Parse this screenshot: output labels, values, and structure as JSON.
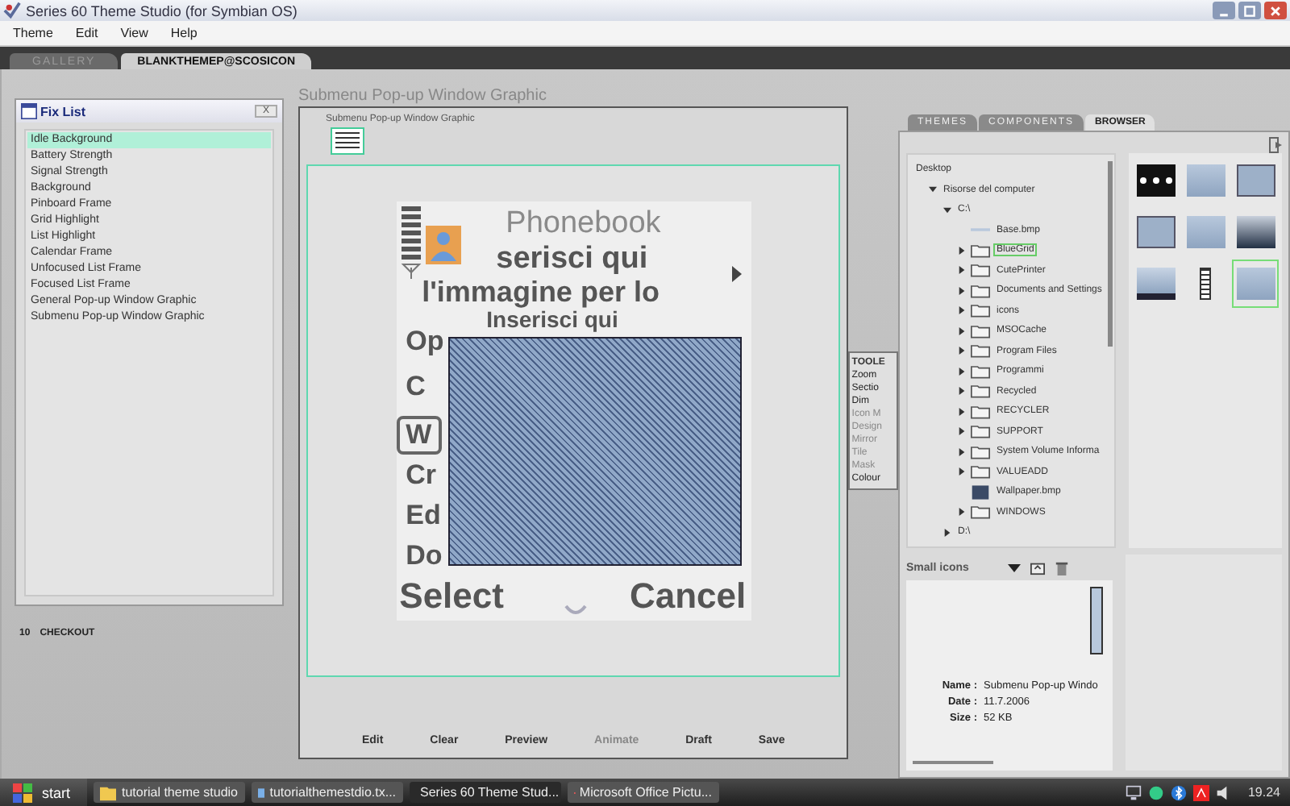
{
  "window": {
    "title": "Series 60 Theme Studio (for Symbian OS)"
  },
  "menu": [
    "Theme",
    "Edit",
    "View",
    "Help"
  ],
  "document_tabs": [
    {
      "label": "GALLERY",
      "selected": false
    },
    {
      "label": "BLANKTHEMEP@SCOSICON",
      "selected": true
    }
  ],
  "fix_list": {
    "title": "Fix List",
    "close_label": "X",
    "items": [
      {
        "label": "Idle Background",
        "selected": true
      },
      {
        "label": "Battery Strength",
        "selected": false
      },
      {
        "label": "Signal Strength",
        "selected": false
      },
      {
        "label": "Background",
        "selected": false
      },
      {
        "label": "Pinboard Frame",
        "selected": false
      },
      {
        "label": "Grid Highlight",
        "selected": false
      },
      {
        "label": "List Highlight",
        "selected": false
      },
      {
        "label": "Calendar Frame",
        "selected": false
      },
      {
        "label": "Unfocused List Frame",
        "selected": false
      },
      {
        "label": "Focused List Frame",
        "selected": false
      },
      {
        "label": "General Pop-up Window Graphic",
        "selected": false
      },
      {
        "label": "Submenu Pop-up Window Graphic",
        "selected": false
      }
    ]
  },
  "checkout": {
    "count": "10",
    "label": "CHECKOUT"
  },
  "editor": {
    "title": "Submenu Pop-up Window Graphic",
    "thumbnail_label": "Submenu Pop-up Window Graphic",
    "phone": {
      "title": "Phonebook",
      "overlay_lines": [
        "serisci qui",
        "l'immagine per lo",
        "Inserisci qui"
      ],
      "menu_letters": [
        {
          "label": "Op",
          "selected": false
        },
        {
          "label": "C",
          "selected": false
        },
        {
          "label": "W",
          "selected": true
        },
        {
          "label": "Cr",
          "selected": false
        },
        {
          "label": "Ed",
          "selected": false
        },
        {
          "label": "Do",
          "selected": false
        }
      ],
      "softkeys": [
        "Select",
        "Cancel"
      ]
    },
    "toolbar": [
      {
        "label": "Edit",
        "disabled": false
      },
      {
        "label": "Clear",
        "disabled": false
      },
      {
        "label": "Preview",
        "disabled": false
      },
      {
        "label": "Animate",
        "disabled": true
      },
      {
        "label": "Draft",
        "disabled": false
      },
      {
        "label": "Save",
        "disabled": false
      }
    ]
  },
  "tools_panel": {
    "title": "TOOLE",
    "items": [
      {
        "label": "Zoom",
        "disabled": false
      },
      {
        "label": "Sectio",
        "disabled": false
      },
      {
        "label": "Dim",
        "disabled": false
      },
      {
        "label": "Icon M",
        "disabled": true
      },
      {
        "label": "Design",
        "disabled": true
      },
      {
        "label": "Mirror",
        "disabled": true
      },
      {
        "label": "Tile",
        "disabled": true
      },
      {
        "label": "Mask",
        "disabled": true
      },
      {
        "label": "Colour",
        "disabled": false
      }
    ]
  },
  "browser": {
    "tabs": [
      {
        "label": "THEMES",
        "selected": false
      },
      {
        "label": "COMPONENTS",
        "selected": false
      },
      {
        "label": "BROWSER",
        "selected": true
      }
    ],
    "tree": [
      {
        "label": "Desktop",
        "selected": false,
        "children": [
          {
            "label": "Risorse del computer",
            "expanded": true,
            "selected": false,
            "children": [
              {
                "label": "C:\\",
                "expanded": true,
                "selected": false,
                "children": [
                  {
                    "label": "Base.bmp",
                    "kind": "file",
                    "selected": false
                  },
                  {
                    "label": "BlueGrid",
                    "kind": "folder",
                    "expanded": false,
                    "selected": true
                  },
                  {
                    "label": "CutePrinter",
                    "kind": "folder",
                    "expanded": false,
                    "selected": false
                  },
                  {
                    "label": "Documents and Settings",
                    "kind": "folder",
                    "expanded": false,
                    "selected": false
                  },
                  {
                    "label": "icons",
                    "kind": "folder",
                    "expanded": false,
                    "selected": false
                  },
                  {
                    "label": "MSOCache",
                    "kind": "folder",
                    "expanded": false,
                    "selected": false
                  },
                  {
                    "label": "Program Files",
                    "kind": "folder",
                    "expanded": false,
                    "selected": false
                  },
                  {
                    "label": "Programmi",
                    "kind": "folder",
                    "expanded": false,
                    "selected": false
                  },
                  {
                    "label": "Recycled",
                    "kind": "folder",
                    "expanded": false,
                    "selected": false
                  },
                  {
                    "label": "RECYCLER",
                    "kind": "folder",
                    "expanded": false,
                    "selected": false
                  },
                  {
                    "label": "SUPPORT",
                    "kind": "folder",
                    "expanded": false,
                    "selected": false
                  },
                  {
                    "label": "System Volume Informa",
                    "kind": "folder",
                    "expanded": false,
                    "selected": false
                  },
                  {
                    "label": "VALUEADD",
                    "kind": "folder",
                    "expanded": false,
                    "selected": false
                  },
                  {
                    "label": "Wallpaper.bmp",
                    "kind": "image",
                    "selected": false
                  },
                  {
                    "label": "WINDOWS",
                    "kind": "folder",
                    "expanded": false,
                    "selected": false
                  }
                ]
              },
              {
                "label": "D:\\",
                "expanded": false,
                "selected": false
              }
            ]
          }
        ]
      }
    ],
    "thumbnails": [
      {
        "kind": "dots",
        "selected": false
      },
      {
        "kind": "light",
        "selected": false
      },
      {
        "kind": "frame",
        "selected": false
      },
      {
        "kind": "frame",
        "selected": false
      },
      {
        "kind": "light",
        "selected": false
      },
      {
        "kind": "dark",
        "selected": false
      },
      {
        "kind": "gradient",
        "selected": false
      },
      {
        "kind": "ladder",
        "selected": false
      },
      {
        "kind": "light",
        "selected": true
      }
    ],
    "view_select": "Small icons",
    "info": [
      {
        "label": "Name :",
        "value": "Submenu Pop-up Windo"
      },
      {
        "label": "Date :",
        "value": "11.7.2006"
      },
      {
        "label": "Size :",
        "value": "52 KB"
      }
    ]
  },
  "taskbar": {
    "start": "start",
    "tasks": [
      {
        "label": "tutorial theme studio",
        "kind": "folder",
        "selected": false
      },
      {
        "label": "tutorialthemestdio.tx...",
        "kind": "document",
        "selected": false
      },
      {
        "label": "Series 60 Theme Stud...",
        "kind": "app",
        "selected": true
      },
      {
        "label": "Microsoft Office Pictu...",
        "kind": "picture",
        "selected": false
      }
    ],
    "clock": "19.24"
  }
}
